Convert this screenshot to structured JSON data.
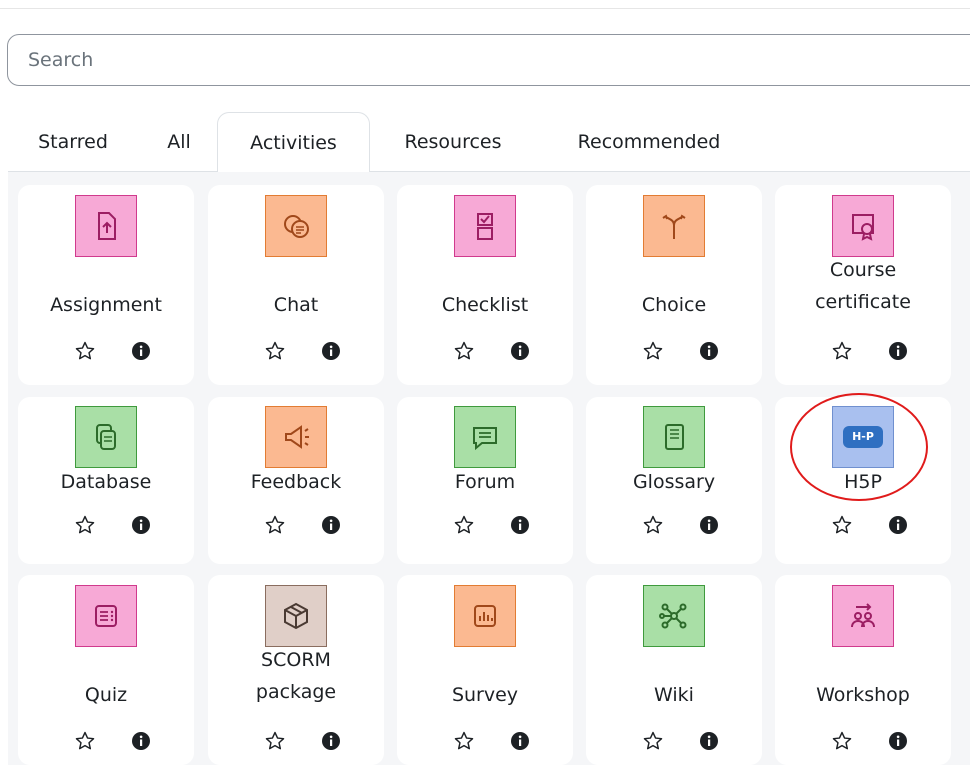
{
  "search": {
    "placeholder": "Search",
    "value": ""
  },
  "tabs": [
    {
      "label": "Starred",
      "active": false
    },
    {
      "label": "All",
      "active": false
    },
    {
      "label": "Activities",
      "active": true
    },
    {
      "label": "Resources",
      "active": false
    },
    {
      "label": "Recommended",
      "active": false
    }
  ],
  "activities": [
    {
      "name": "Assignment",
      "icon": "assignment-icon",
      "color": "pink"
    },
    {
      "name": "Chat",
      "icon": "chat-icon",
      "color": "orange"
    },
    {
      "name": "Checklist",
      "icon": "checklist-icon",
      "color": "pink"
    },
    {
      "name": "Choice",
      "icon": "choice-icon",
      "color": "orange"
    },
    {
      "name": "Course\ncertificate",
      "icon": "certificate-icon",
      "color": "pink"
    },
    {
      "name": "Database",
      "icon": "database-icon",
      "color": "green"
    },
    {
      "name": "Feedback",
      "icon": "feedback-icon",
      "color": "orange"
    },
    {
      "name": "Forum",
      "icon": "forum-icon",
      "color": "green"
    },
    {
      "name": "Glossary",
      "icon": "glossary-icon",
      "color": "green"
    },
    {
      "name": "H5P",
      "icon": "h5p-icon",
      "color": "blue",
      "icon_text": "H-P",
      "highlighted": true
    },
    {
      "name": "Quiz",
      "icon": "quiz-icon",
      "color": "pink"
    },
    {
      "name": "SCORM\npackage",
      "icon": "scorm-package-icon",
      "color": "brown"
    },
    {
      "name": "Survey",
      "icon": "survey-icon",
      "color": "orange"
    },
    {
      "name": "Wiki",
      "icon": "wiki-icon",
      "color": "green"
    },
    {
      "name": "Workshop",
      "icon": "workshop-icon",
      "color": "pink"
    }
  ],
  "colors": {
    "pink": "#f7a9d6",
    "orange": "#fbb991",
    "green": "#a9dfa6",
    "blue": "#a9c0ef",
    "brown": "#e0cfc8",
    "highlight": "#e01b1b"
  }
}
